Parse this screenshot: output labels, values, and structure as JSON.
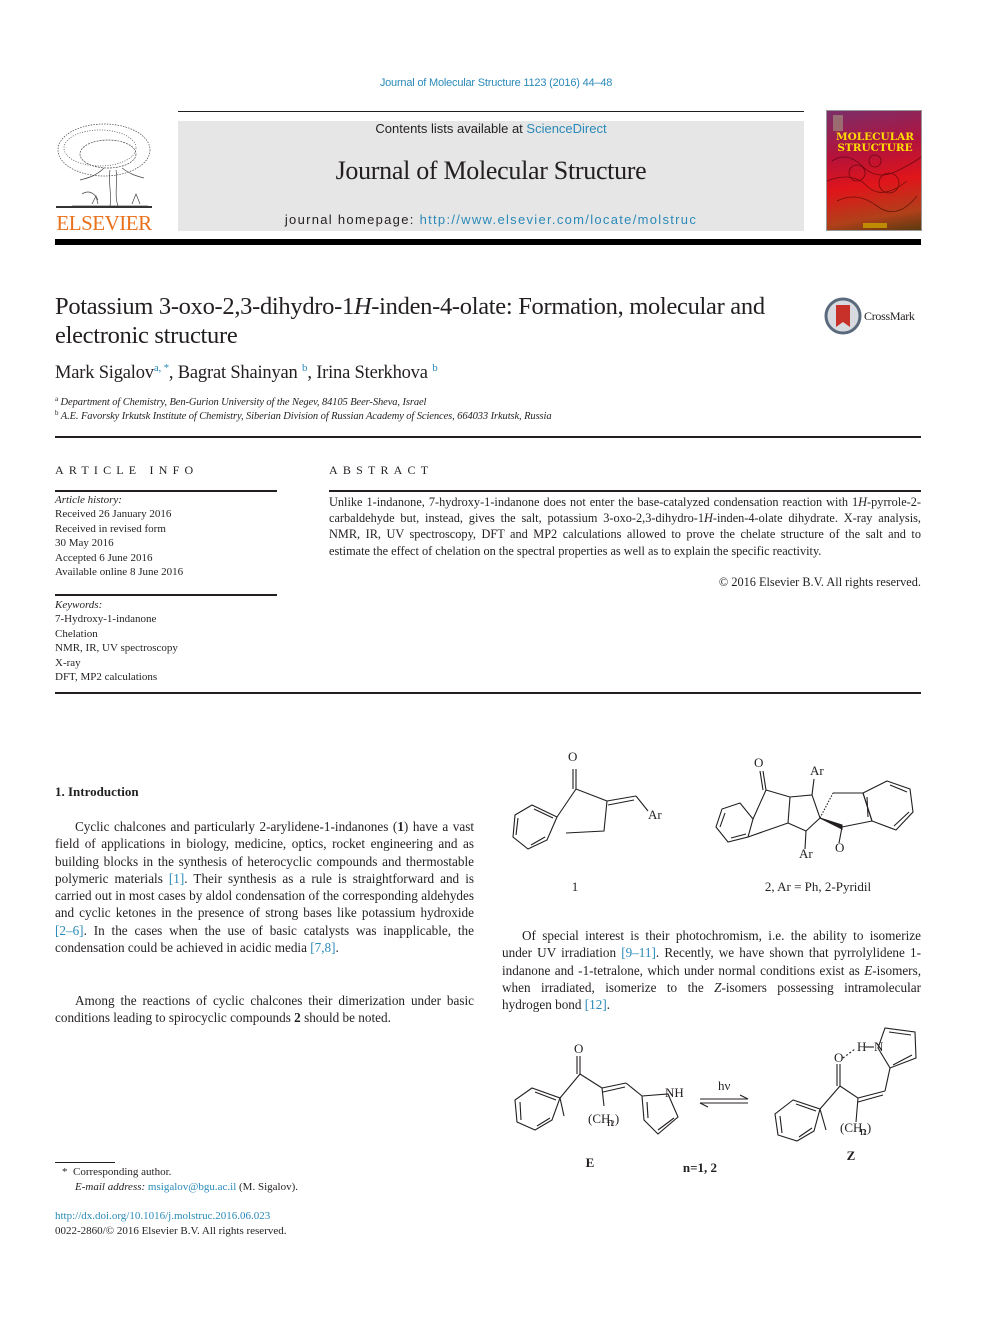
{
  "header": {
    "journal_reference": "Journal of Molecular Structure 1123 (2016) 44–48",
    "contents_prefix": "Contents lists available at ",
    "contents_link": "ScienceDirect",
    "journal_title": "Journal of Molecular Structure",
    "homepage_prefix": "journal homepage: ",
    "homepage_url": "http://www.elsevier.com/locate/molstruc",
    "publisher_logo_text": "ELSEVIER",
    "cover_title_line1": "MOLECULAR",
    "cover_title_line2": "STRUCTURE",
    "crossmark_label": "CrossMark",
    "colors": {
      "link": "#2a8ab8",
      "elsevier_orange": "#e9711c",
      "banner_bg": "#e6e6e6"
    }
  },
  "article": {
    "title_part1": "Potassium 3-oxo-2,3-dihydro-1",
    "title_italic": "H",
    "title_part2": "-inden-4-olate: Formation, molecular and electronic structure",
    "authors": [
      {
        "name": "Mark Sigalov",
        "sup": "a, *"
      },
      {
        "name": "Bagrat Shainyan",
        "sup": "b"
      },
      {
        "name": "Irina Sterkhova",
        "sup": "b"
      }
    ],
    "affiliations": [
      {
        "mark": "a",
        "text": "Department of Chemistry, Ben-Gurion University of the Negev, 84105 Beer-Sheva, Israel"
      },
      {
        "mark": "b",
        "text": "A.E. Favorsky Irkutsk Institute of Chemistry, Siberian Division of Russian Academy of Sciences, 664033 Irkutsk, Russia"
      }
    ]
  },
  "article_info": {
    "heading": "ARTICLE INFO",
    "history_label": "Article history:",
    "history": [
      "Received 26 January 2016",
      "Received in revised form",
      "30 May 2016",
      "Accepted 6 June 2016",
      "Available online 8 June 2016"
    ],
    "keywords_label": "Keywords:",
    "keywords": [
      "7-Hydroxy-1-indanone",
      "Chelation",
      "NMR, IR, UV spectroscopy",
      "X-ray",
      "DFT, MP2 calculations"
    ]
  },
  "abstract": {
    "heading": "ABSTRACT",
    "text_a": "Unlike 1-indanone, 7-hydroxy-1-indanone does not enter the base-catalyzed condensation reaction with 1",
    "text_b": "-pyrrole-2-carbaldehyde but, instead, gives the salt, potassium 3-oxo-2,3-dihydro-1",
    "text_c": "-inden-4-olate dihydrate. X-ray analysis, NMR, IR, UV spectroscopy, DFT and MP2 calculations allowed to prove the chelate structure of the salt and to estimate the effect of chelation on the spectral properties as well as to explain the specific reactivity.",
    "italic_h": "H",
    "copyright": "© 2016 Elsevier B.V. All rights reserved."
  },
  "introduction": {
    "heading": "1.  Introduction",
    "p1_a": "Cyclic chalcones and particularly 2-arylidene-1-indanones (",
    "p1_bold": "1",
    "p1_b": ") have a vast field of applications in biology, medicine, optics, rocket engineering and as building blocks in the synthesis of heterocyclic compounds and thermostable polymeric materials ",
    "p1_cite1": "[1]",
    "p1_c": ". Their synthesis as a rule is straightforward and is carried out in most cases by aldol condensation of the corresponding aldehydes and cyclic ketones in the presence of strong bases like potassium hydroxide ",
    "p1_cite2": "[2–6]",
    "p1_d": ". In the cases when the use of basic catalysts was inapplicable, the condensation could be achieved in acidic media ",
    "p1_cite3": "[7,8]",
    "p1_e": ".",
    "p2_a": "Among the reactions of cyclic chalcones their dimerization under basic conditions leading to spirocyclic compounds ",
    "p2_bold": "2",
    "p2_b": " should be noted.",
    "p3_a": "Of special interest is their photochromism, i.e. the ability to isomerize under UV irradiation ",
    "p3_cite1": "[9–11]",
    "p3_b": ". Recently, we have shown that pyrrolylidene 1-indanone and -1-tetralone, which under normal conditions exist as ",
    "p3_e": "E",
    "p3_c": "-isomers, when irradiated, isomerize to the ",
    "p3_z": "Z",
    "p3_d": "-isomers possessing intramolecular hydrogen bond ",
    "p3_cite2": "[12]",
    "p3_f": "."
  },
  "schemes": {
    "scheme1": {
      "compound1_label": "1",
      "compound2_label": "2, Ar = Ph, 2-Pyridil",
      "atom_O": "O",
      "atom_Ar": "Ar"
    },
    "scheme2": {
      "left_label": "E",
      "right_label": "Z",
      "condition": "n=1, 2",
      "arrow_label": "hν",
      "atom_O": "O",
      "atom_NH": "NH",
      "atom_H": "H",
      "atom_N": "N",
      "ch2": "(CH₂)",
      "n": "n"
    }
  },
  "footnotes": {
    "star": "*",
    "corresponding": "Corresponding author.",
    "email_label": "E-mail address:",
    "email": "msigalov@bgu.ac.il",
    "email_suffix": " (M. Sigalov).",
    "doi": "http://dx.doi.org/10.1016/j.molstruc.2016.06.023",
    "issn_line": "0022-2860/© 2016 Elsevier B.V. All rights reserved."
  }
}
